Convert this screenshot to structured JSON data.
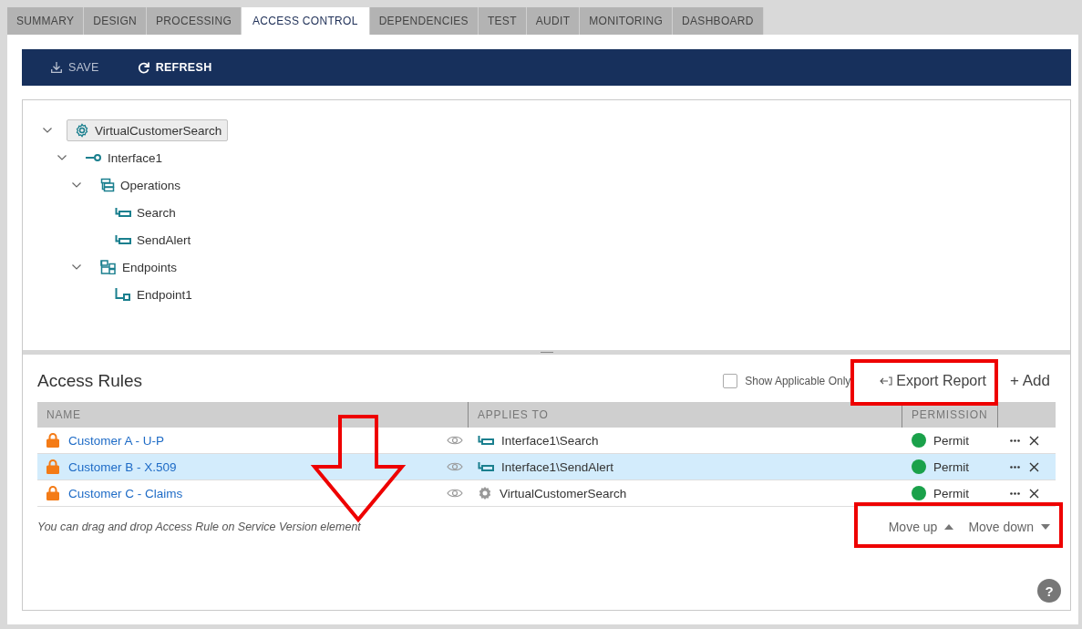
{
  "tabs": [
    {
      "label": "SUMMARY",
      "selected": false
    },
    {
      "label": "DESIGN",
      "selected": false
    },
    {
      "label": "PROCESSING",
      "selected": false
    },
    {
      "label": "ACCESS CONTROL",
      "selected": true
    },
    {
      "label": "DEPENDENCIES",
      "selected": false
    },
    {
      "label": "TEST",
      "selected": false
    },
    {
      "label": "AUDIT",
      "selected": false
    },
    {
      "label": "MONITORING",
      "selected": false
    },
    {
      "label": "DASHBOARD",
      "selected": false
    }
  ],
  "toolbar": {
    "buttons": [
      {
        "kind": "save",
        "label": "SAVE",
        "disabled": true
      },
      {
        "kind": "refresh",
        "label": "REFRESH",
        "disabled": false
      }
    ]
  },
  "tree": [
    {
      "kind": "service",
      "label": "VirtualCustomerSearch",
      "expanded": true,
      "selected": true,
      "children": [
        {
          "kind": "interface",
          "label": "Interface1",
          "expanded": true,
          "selected": false,
          "children": [
            {
              "kind": "operations",
              "label": "Operations",
              "expanded": true,
              "selected": false,
              "children": [
                {
                  "kind": "operation",
                  "label": "Search",
                  "selected": false
                },
                {
                  "kind": "operation",
                  "label": "SendAlert",
                  "selected": false
                }
              ]
            },
            {
              "kind": "endpoints",
              "label": "Endpoints",
              "expanded": true,
              "selected": false,
              "children": [
                {
                  "kind": "endpoint",
                  "label": "Endpoint1",
                  "selected": false
                }
              ]
            }
          ]
        }
      ]
    }
  ],
  "access_rules": {
    "title": "Access Rules",
    "show_applicable_only": {
      "label": "Show Applicable Only",
      "checked": false
    },
    "export_report": "Export Report",
    "add": "+ Add",
    "columns": [
      "NAME",
      "APPLIES TO",
      "PERMISSION"
    ],
    "rows": [
      {
        "name": "Customer A - U-P",
        "kind": "operation",
        "applies_to": "Interface1\\Search",
        "permission": "Permit",
        "color": "#1aa14a",
        "selected": false
      },
      {
        "name": "Customer B - X.509",
        "kind": "operation",
        "applies_to": "Interface1\\SendAlert",
        "permission": "Permit",
        "color": "#1aa14a",
        "selected": true
      },
      {
        "name": "Customer C - Claims",
        "kind": "service_gray",
        "applies_to": "VirtualCustomerSearch",
        "permission": "Permit",
        "color": "#1aa14a",
        "selected": false
      }
    ],
    "hint": "You can drag and drop Access Rule on Service Version element",
    "move_up": "Move up",
    "move_down": "Move down",
    "help": "?"
  }
}
